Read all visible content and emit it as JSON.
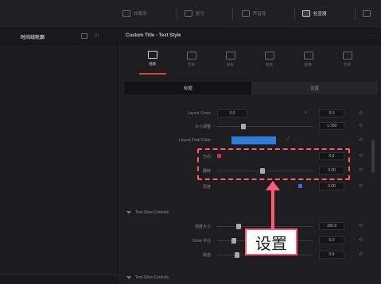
{
  "topbar": {
    "buttons": [
      {
        "label": "效果库",
        "icon": "effects-library-icon"
      },
      {
        "label": "索引",
        "icon": "index-icon"
      },
      {
        "label": "声音库",
        "icon": "sound-library-icon"
      },
      {
        "label": "检查器",
        "icon": "inspector-icon"
      }
    ]
  },
  "secbar": {
    "left_title": "时间线轮廓",
    "left_small": "1/1",
    "inspector_title": "Custom Title - Text Style",
    "more": "···"
  },
  "inspector": {
    "tabs": [
      {
        "label": "视频",
        "icon": "video-icon"
      },
      {
        "label": "音频",
        "icon": "audio-icon"
      },
      {
        "label": "效果",
        "icon": "effects-icon"
      },
      {
        "label": "转场",
        "icon": "transition-icon"
      },
      {
        "label": "图像",
        "icon": "image-icon"
      },
      {
        "label": "文件",
        "icon": "file-icon"
      }
    ],
    "subtabs": [
      "标题",
      "设置"
    ],
    "rows": [
      {
        "label": "Layout Cross",
        "field": "0.0",
        "minilbl2": "Y",
        "value": "0.0"
      },
      {
        "label": "大小调整",
        "value": "1.700"
      },
      {
        "label": "Layout Total Color"
      },
      {
        "label": "方向",
        "value": "0.0"
      },
      {
        "label": "翻转",
        "value": "0.00"
      },
      {
        "label": "厚度",
        "value": "0.00"
      }
    ],
    "section1": "Text Glow Controls",
    "rows2": [
      {
        "label": "强度大小",
        "value": "100.0"
      },
      {
        "label": "Glow 半径",
        "value": "0.0"
      },
      {
        "label": "阈值",
        "value": "0.0"
      }
    ],
    "section2": "Text Glow Controls",
    "reset_glyph": "⟲"
  },
  "annotation": {
    "callout": "设置",
    "accent": "#ff5b72"
  }
}
